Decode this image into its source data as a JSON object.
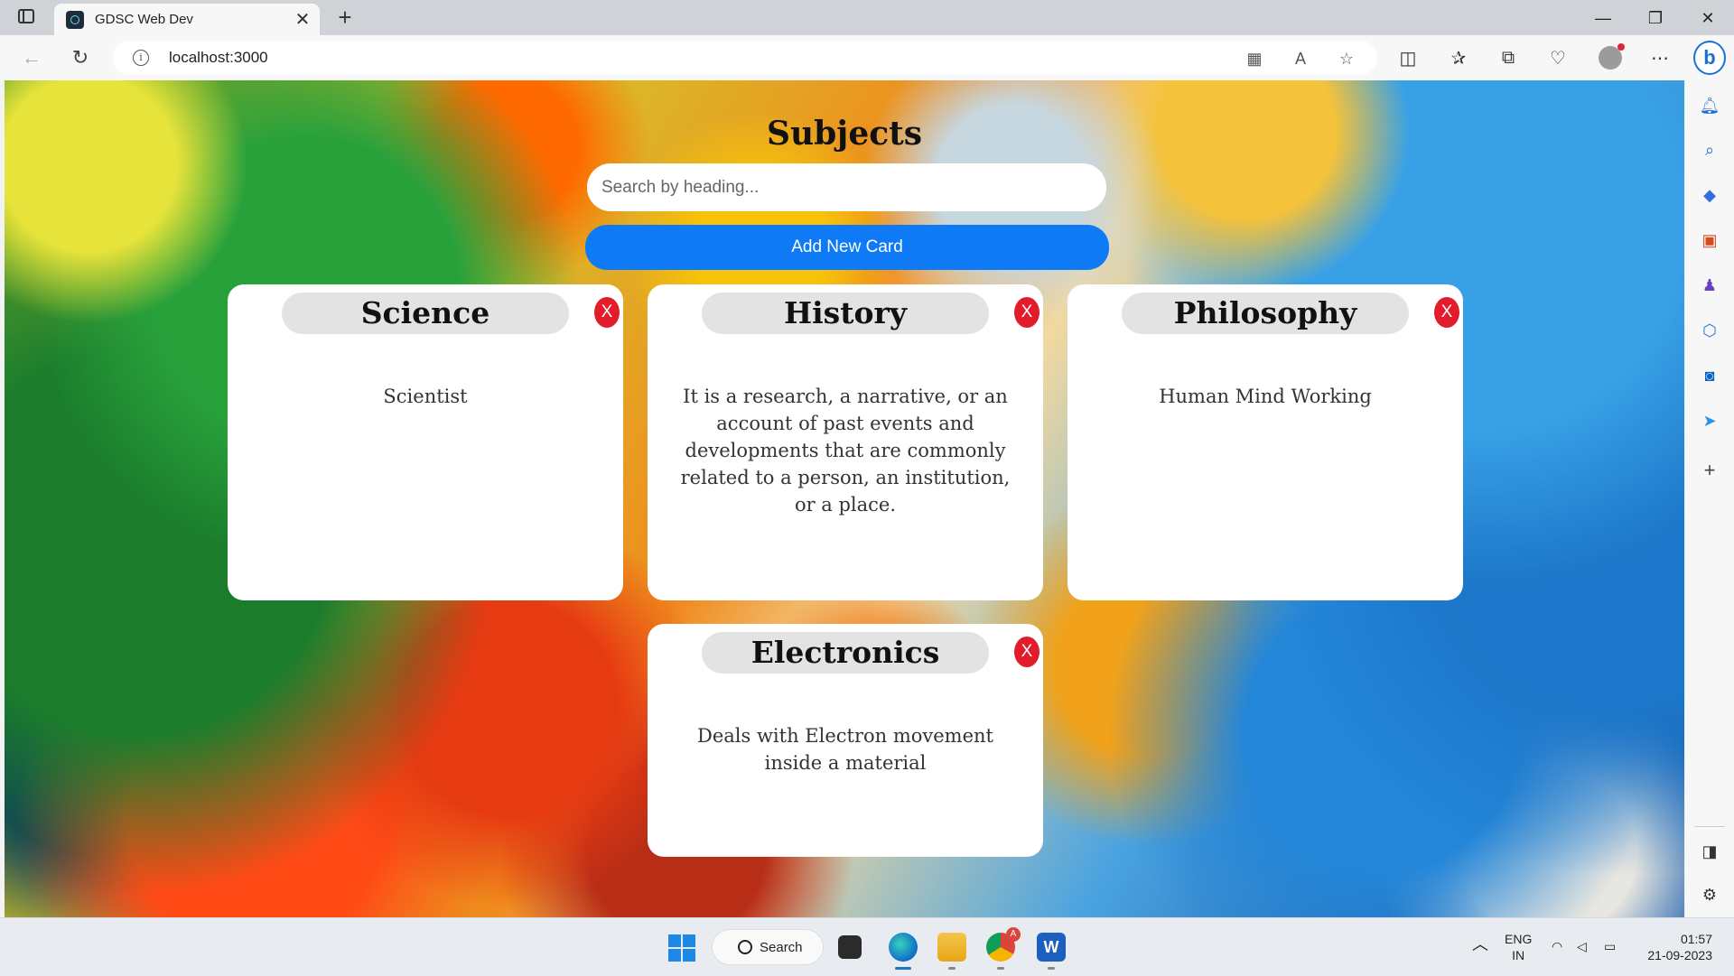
{
  "browser": {
    "tab_title": "GDSC Web Dev",
    "new_tab_glyph": "+",
    "tab_close_glyph": "✕",
    "url": "localhost:3000",
    "window": {
      "minimize": "—",
      "restore": "❐",
      "close": "✕"
    },
    "nav": {
      "back": "←",
      "refresh": "↻"
    },
    "toolbar_icons": [
      "apps-icon",
      "read-aloud-icon",
      "favorite-star-icon",
      "split-screen-icon",
      "favorites-icon",
      "collections-icon",
      "browser-essentials-icon",
      "more-icon"
    ],
    "bing_label": "b"
  },
  "page": {
    "heading": "Subjects",
    "search_placeholder": "Search by heading...",
    "add_button": "Add New Card",
    "delete_label": "X",
    "cards": [
      {
        "title": "Science",
        "body": "Scientist"
      },
      {
        "title": "History",
        "body": "It is a research, a narrative, or an account of past events and developments that are commonly related to a person, an institution, or a place."
      },
      {
        "title": "Philosophy",
        "body": "Human Mind Working"
      },
      {
        "title": "Electronics",
        "body": "Deals with Electron movement inside a material"
      }
    ]
  },
  "sidebar_icons": [
    "bell-icon",
    "search-icon",
    "tag-icon",
    "toolbox-icon",
    "games-icon",
    "office-icon",
    "outlook-icon",
    "send-icon",
    "add-icon",
    "sidebar-panel-icon",
    "settings-icon"
  ],
  "taskbar": {
    "search_label": "Search",
    "apps": [
      "file-explorer-icon",
      "edge-icon",
      "folder-icon",
      "chrome-icon",
      "word-icon"
    ],
    "chrome_badge": "A",
    "lang_top": "ENG",
    "lang_bottom": "IN",
    "time": "01:57",
    "date": "21-09-2023"
  },
  "colors": {
    "add_button": "#0f7af5",
    "delete_button": "#e21c2a",
    "card_background": "#ffffff",
    "card_title_pill": "#e3e3e3"
  }
}
